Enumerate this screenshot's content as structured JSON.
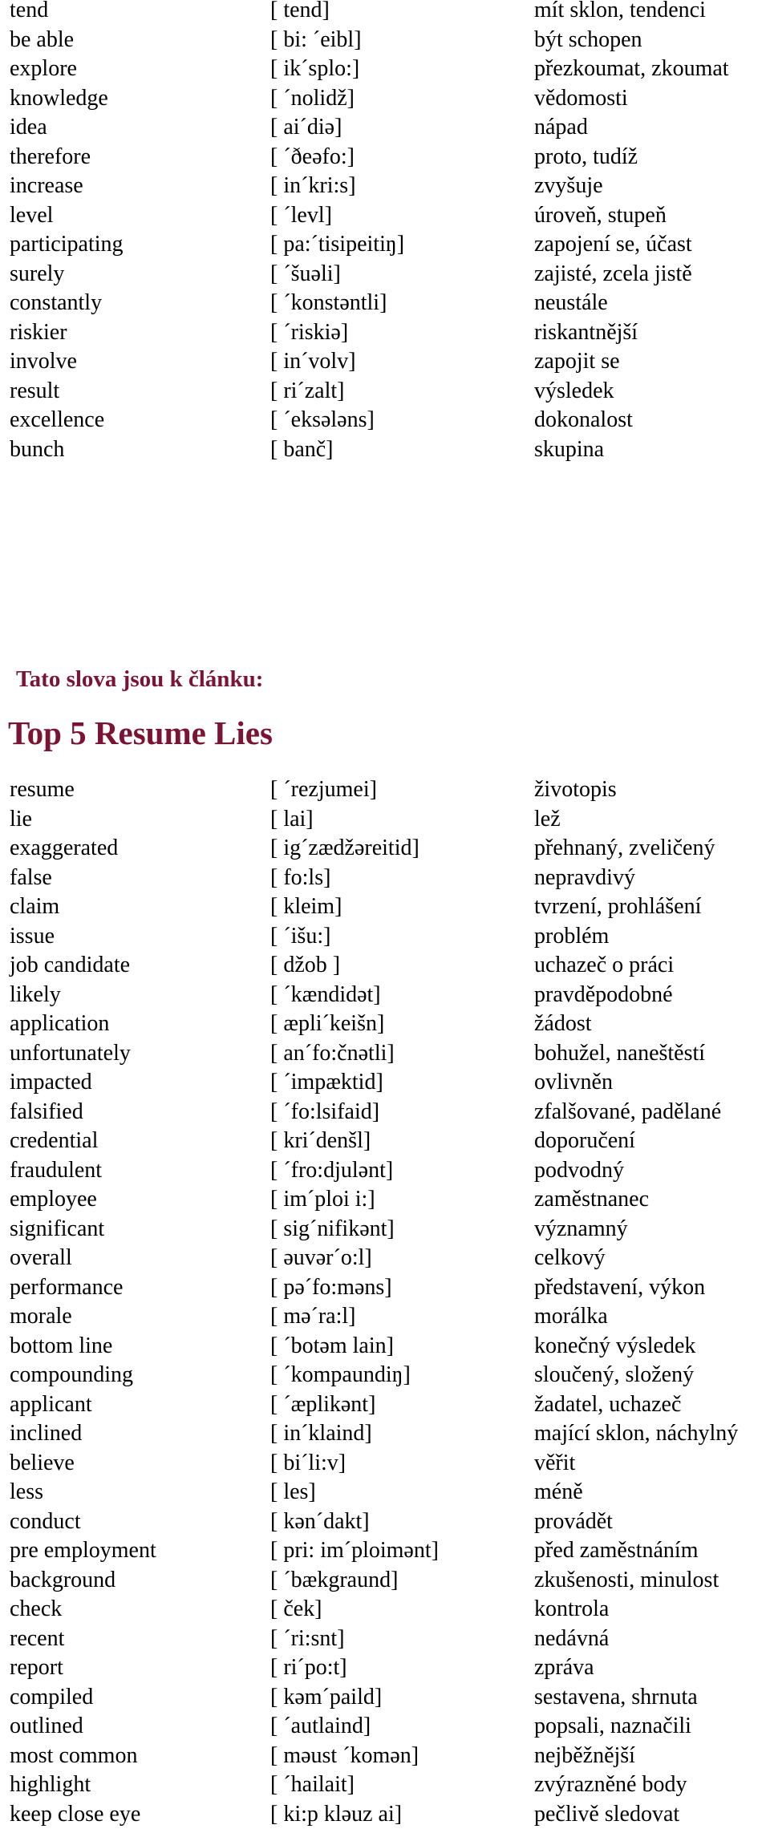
{
  "colors": {
    "heading": "#7b1434",
    "text": "#000000"
  },
  "block1": [
    [
      "tend",
      "[ tend]",
      "mít sklon, tendenci"
    ],
    [
      "be able",
      "[ bi: ´eibl]",
      "být schopen"
    ],
    [
      "explore",
      "[ ik´splo:]",
      "přezkoumat, zkoumat"
    ],
    [
      "knowledge",
      "[ ´nolidž]",
      "vědomosti"
    ],
    [
      "idea",
      "[ ai´diə]",
      "nápad"
    ],
    [
      "therefore",
      "[ ´ðeəfo:]",
      "proto, tudíž"
    ],
    [
      "increase",
      "[ in´kri:s]",
      "zvyšuje"
    ],
    [
      "level",
      "[ ´levl]",
      "úroveň, stupeň"
    ],
    [
      "participating",
      "[ pa:´tisipeitiŋ]",
      "zapojení se, účast"
    ],
    [
      "surely",
      "[ ´šuəli]",
      "zajisté, zcela jistě"
    ],
    [
      "constantly",
      "[ ´konstəntli]",
      "neustále"
    ],
    [
      "riskier",
      "[ ´riskiə]",
      "riskantnější"
    ],
    [
      "involve",
      "[ in´volv]",
      "zapojit se"
    ],
    [
      "result",
      "[ ri´zalt]",
      "výsledek"
    ],
    [
      "excellence",
      "[ ´eksələns]",
      "dokonalost"
    ],
    [
      "bunch",
      "[ banč]",
      "skupina"
    ]
  ],
  "section_heading": "Tato slova jsou k článku:",
  "article_title": "Top 5 Resume Lies",
  "block2": [
    [
      "resume",
      "[ ´rezjumei]",
      "životopis"
    ],
    [
      "lie",
      "[ lai]",
      "lež"
    ],
    [
      "exaggerated",
      "[ ig´zædžəreitid]",
      "přehnaný, zveličený"
    ],
    [
      "false",
      "[ fo:ls]",
      "nepravdivý"
    ],
    [
      "claim",
      "[ kleim]",
      "tvrzení, prohlášení"
    ],
    [
      "issue",
      "[ ´išu:]",
      "problém"
    ],
    [
      "job candidate",
      "[ džob ]",
      "uchazeč o práci"
    ],
    [
      "likely",
      "[ ´kændidət]",
      "pravděpodobné"
    ],
    [
      "application",
      "[ æpli´keišn]",
      "žádost"
    ],
    [
      "unfortunately",
      "[ an´fo:čnətli]",
      "bohužel, naneštěstí"
    ],
    [
      "impacted",
      "[ ´impæktid]",
      "ovlivněn"
    ],
    [
      "falsified",
      "[ ´fo:lsifaid]",
      "zfalšované, padělané"
    ],
    [
      "credential",
      "[ kri´denšl]",
      "doporučení"
    ],
    [
      "fraudulent",
      "[ ´fro:djulənt]",
      "podvodný"
    ],
    [
      "employee",
      "[ im´ploi i:]",
      "zaměstnanec"
    ],
    [
      "significant",
      "[ sig´nifikənt]",
      "významný"
    ],
    [
      "overall",
      "[ əuvər´o:l]",
      "celkový"
    ],
    [
      "performance",
      "[ pə´fo:məns]",
      "představení, výkon"
    ],
    [
      "morale",
      "[ mə´ra:l]",
      "morálka"
    ],
    [
      "bottom line",
      "[ ´botəm lain]",
      "konečný výsledek"
    ],
    [
      "compounding",
      "[ ´kompaundiŋ]",
      "sloučený, složený"
    ],
    [
      "applicant",
      "[ ´æplikənt]",
      "žadatel, uchazeč"
    ],
    [
      "inclined",
      "[ in´klaind]",
      "mající sklon, náchylný"
    ],
    [
      "believe",
      "[ bi´li:v]",
      "věřit"
    ],
    [
      "less",
      "[ les]",
      "méně"
    ],
    [
      "conduct",
      "[ kən´dakt]",
      "provádět"
    ],
    [
      "pre employment",
      "[ pri: im´ploimənt]",
      "před zaměstnáním"
    ],
    [
      "background",
      "[ ´bækgraund]",
      "zkušenosti, minulost"
    ],
    [
      "check",
      "[ ček]",
      "kontrola"
    ],
    [
      "recent",
      "[ ´ri:snt]",
      "nedávná"
    ],
    [
      "report",
      "[ ri´po:t]",
      "zpráva"
    ],
    [
      "compiled",
      "[ kəm´paild]",
      "sestavena, shrnuta"
    ],
    [
      "outlined",
      "[ ´autlaind]",
      "popsali, naznačili"
    ],
    [
      "most common",
      "[ məust ´komən]",
      "nejběžnější"
    ],
    [
      "highlight",
      "[ ´hailait]",
      "zvýrazněné body"
    ],
    [
      "keep close eye",
      "[ ki:p kləuz ai]",
      "pečlivě sledovat"
    ]
  ]
}
